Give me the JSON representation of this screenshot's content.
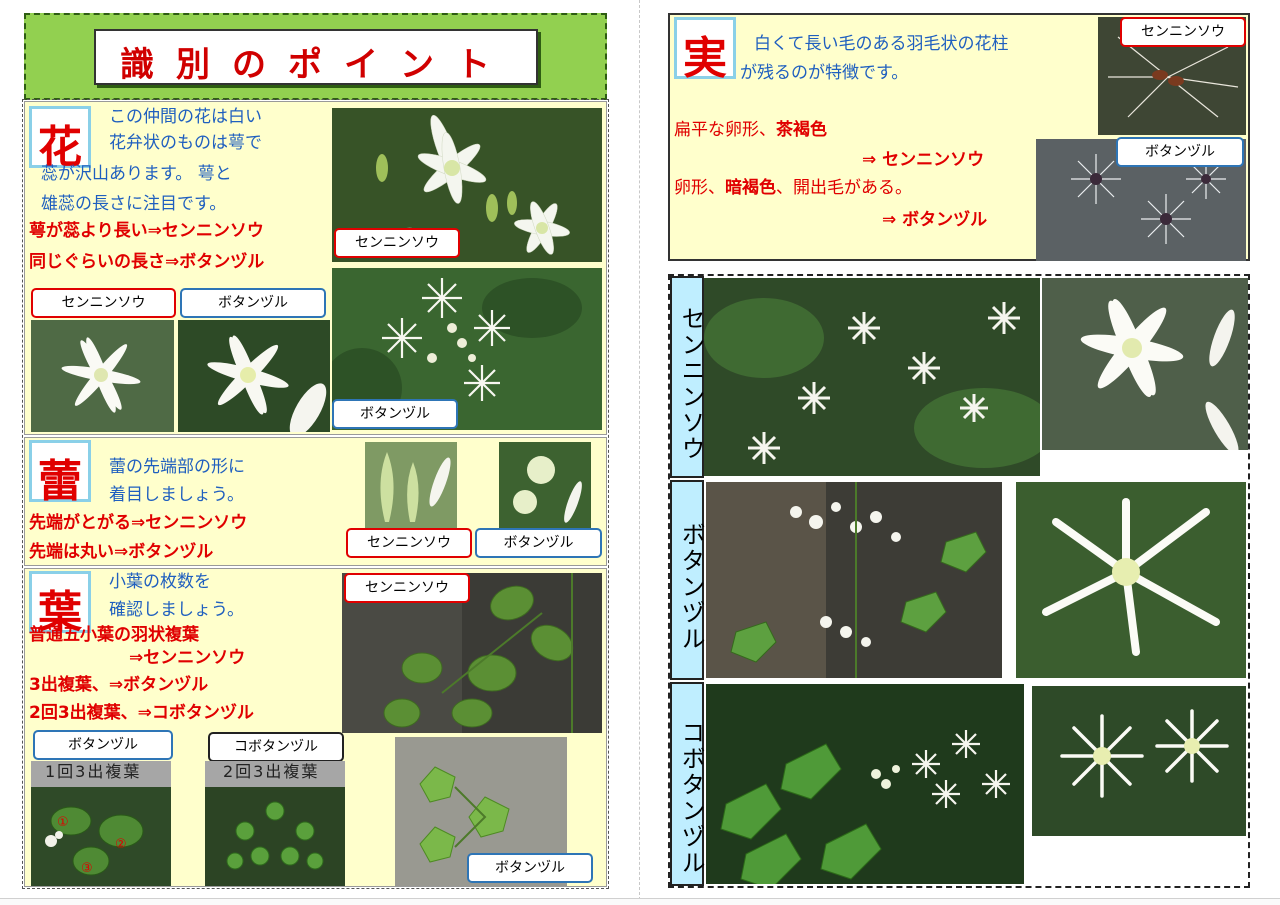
{
  "title": "識別のポイント",
  "flower": {
    "kanji": "花",
    "desc_lines": [
      "この仲間の花は白い",
      "花弁状のものは萼で",
      "蕊が沢山あります。 萼と",
      "雄蕊の長さに注目です。"
    ],
    "rule1": "萼が蕊より長い⇒センニンソウ",
    "rule2": "同じぐらいの長さ⇒ボタンヅル",
    "label_sennin_main": "センニンソウ",
    "label_botan_main": "ボタンヅル",
    "label_sennin_small": "センニンソウ",
    "label_botan_small": "ボタンヅル"
  },
  "bud": {
    "kanji": "蕾",
    "desc_lines": [
      "蕾の先端部の形に",
      "着目しましょう。"
    ],
    "rule1": "先端がとがる⇒センニンソウ",
    "rule2": "先端は丸い⇒ボタンヅル",
    "label_sennin": "センニンソウ",
    "label_botan": "ボタンヅル"
  },
  "leaf": {
    "kanji": "葉",
    "desc_lines": [
      "小葉の枚数を",
      "確認しましょう。"
    ],
    "rule1": "普通五小葉の羽状複葉",
    "rule1b": "⇒センニンソウ",
    "rule2": "3出複葉、⇒ボタンヅル",
    "rule3": "2回3出複葉、⇒コボタンヅル",
    "label_sennin": "センニンソウ",
    "label_botan": "ボタンヅル",
    "label_kobotan": "コボタンヅル",
    "label_botan_bottom": "ボタンヅル",
    "caption_1kai": "1回3出複葉",
    "caption_2kai": "2回3出複葉",
    "leaflet_numbers": [
      "①",
      "②",
      "③"
    ]
  },
  "fruit": {
    "kanji": "実",
    "desc_lines": [
      "白くて長い毛のある羽毛状の花柱",
      "が残るのが特徴です。"
    ],
    "rule1_prefix": "扁平な卵形、",
    "rule1_bold": "茶褐色",
    "rule1_result": "⇒  センニンソウ",
    "rule2_prefix": "卵形、",
    "rule2_bold": "暗褐色",
    "rule2_suffix": "、開出毛がある。",
    "rule2_result": "⇒  ボタンヅル",
    "label_sennin": "センニンソウ",
    "label_botan": "ボタンヅル"
  },
  "gallery": {
    "row1_label": "センニンソウ",
    "row2_label": "ボタンヅル",
    "row3_label": "コボタンヅル"
  },
  "colors": {
    "title_red": "#d00000",
    "accent_red": "#e00000",
    "text_blue": "#1f5fbf",
    "section_bg": "#ffffcc",
    "banner_green": "#92d050",
    "label_blue_border": "#2e75b6",
    "side_label_bg": "#bfeeff"
  }
}
